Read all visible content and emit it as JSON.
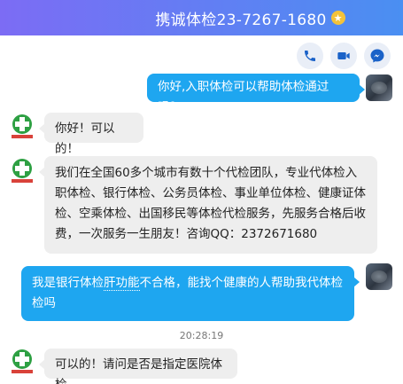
{
  "header": {
    "title": "携诚体检23-7267-1680",
    "star_icon": "star-icon",
    "background_from": "#7c6cf4",
    "background_to": "#4a8ff2"
  },
  "actions": [
    {
      "name": "phone-button",
      "icon": "phone-icon"
    },
    {
      "name": "video-button",
      "icon": "video-icon"
    },
    {
      "name": "messenger-button",
      "icon": "messenger-icon"
    }
  ],
  "messages": [
    {
      "side": "right",
      "text": "你好,入职体检可以帮助体检通过吗？"
    },
    {
      "side": "left",
      "text": "你好！可以的！"
    },
    {
      "side": "left",
      "text": "我们在全国60多个城市有数十个代检团队，专业代体检入职体检、银行体检、公务员体检、事业单位体检、健康证体检、空乘体检、出国移民等体检代检服务，先服务合格后收费，一次服务一生朋友！咨询QQ：2372671680"
    },
    {
      "side": "right",
      "text_a": "我是银行体检",
      "text_b": "肝功能",
      "text_c": "不合格，能找个健康的人帮助我代体检检吗"
    },
    {
      "side": "left",
      "text": "可以的！请问是否是指定医院体检"
    }
  ],
  "timestamp": "20:28:19",
  "colors": {
    "user_bubble": "#1ea6f0",
    "bot_bubble": "#eeeeee",
    "action_bg": "#e9eef7",
    "icon": "#1a62c8"
  }
}
